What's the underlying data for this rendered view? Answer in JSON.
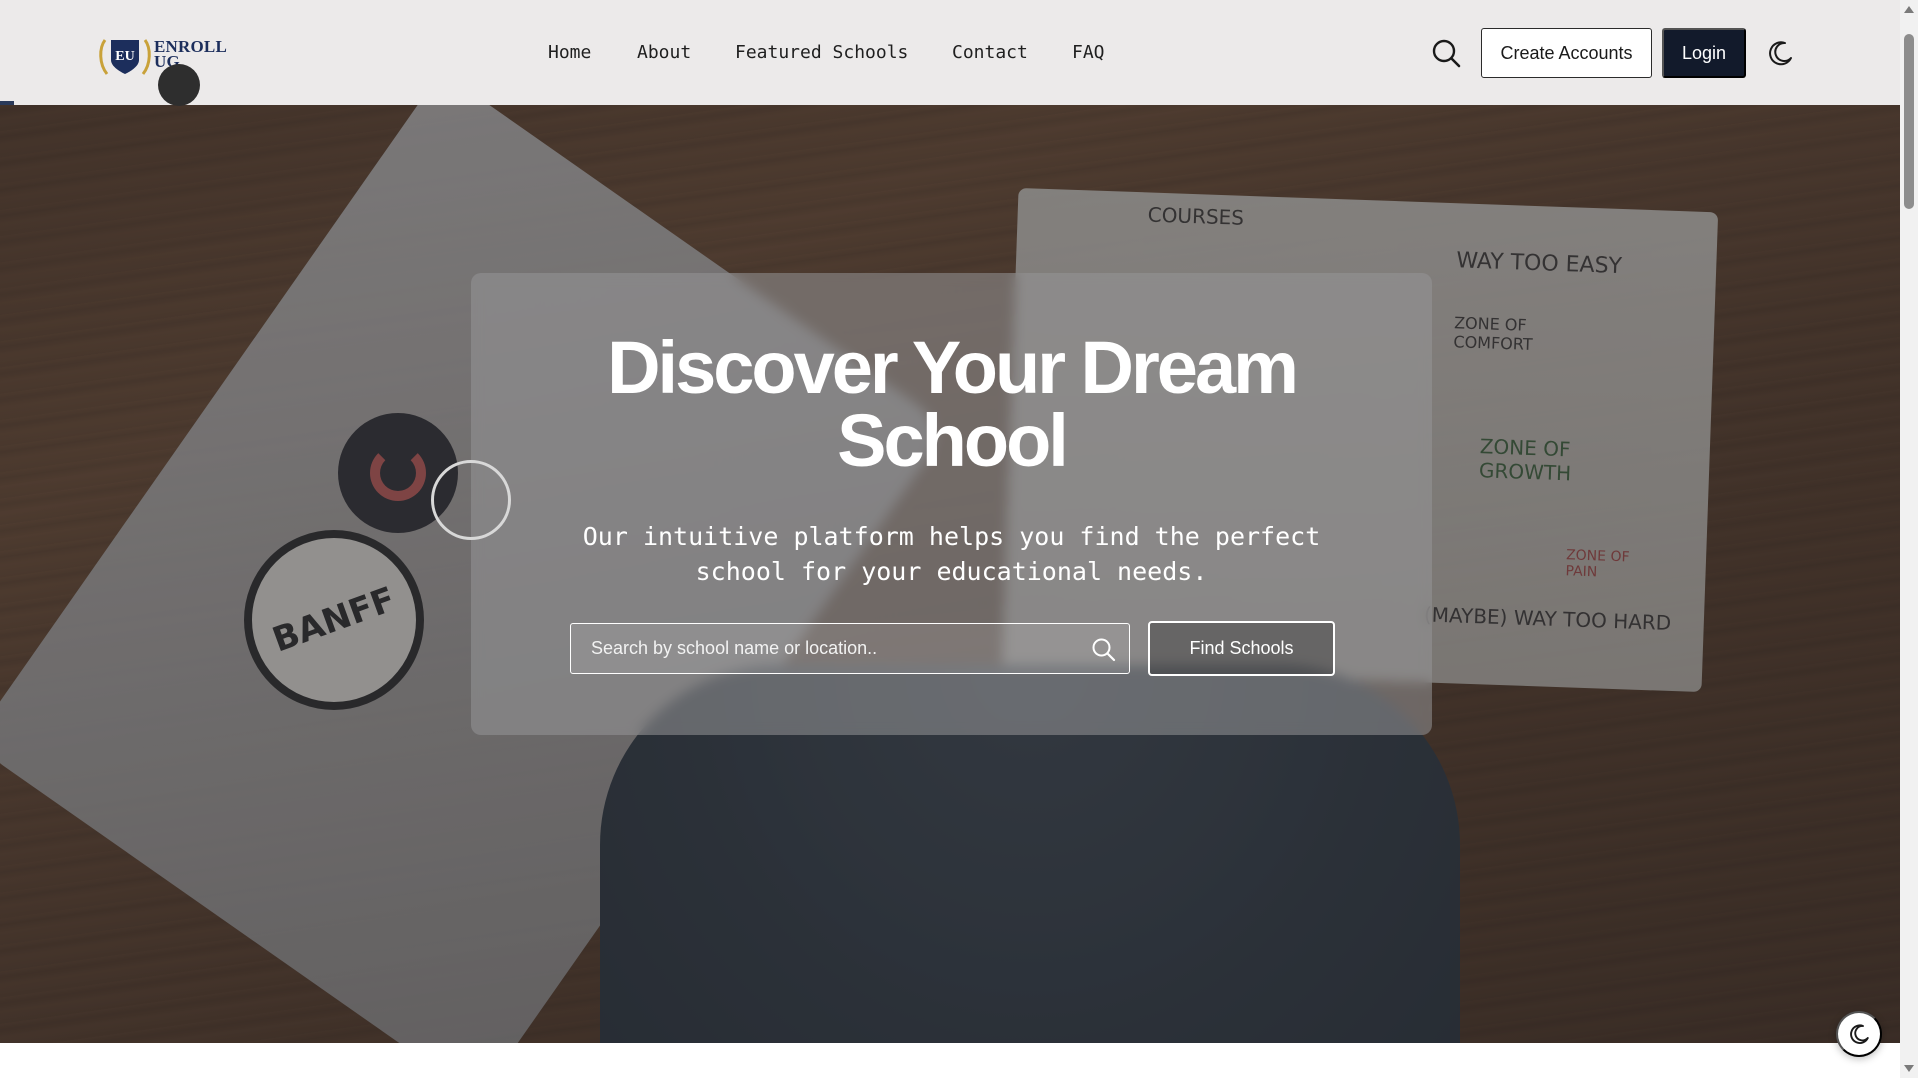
{
  "brand": {
    "logo_initials": "EU",
    "logo_line1": "ENROLL",
    "logo_line2": "UG"
  },
  "nav": {
    "links": [
      "Home",
      "About",
      "Featured Schools",
      "Contact",
      "FAQ"
    ],
    "create_label": "Create Accounts",
    "login_label": "Login",
    "search_icon": "search-icon",
    "theme_icon": "moon-icon"
  },
  "hero": {
    "title_line1": "Discover Your Dream",
    "title_line2": "School",
    "subtitle": "Our intuitive platform helps you find the perfect school for your educational needs.",
    "search_placeholder": "Search by school name or location..",
    "search_value": "",
    "find_label": "Find Schools"
  },
  "background": {
    "notebook_heading": "COURSES",
    "notebook_line1": "WAY TOO EASY",
    "notebook_line2": "ZONE OF COMFORT",
    "notebook_line3": "ZONE OF GROWTH",
    "notebook_line4": "ZONE OF PAIN",
    "notebook_line5": "(MAYBE) WAY TOO HARD",
    "sticker_text": "BANFF"
  },
  "colors": {
    "nav_bg": "#eceaea",
    "login_bg": "#121a2b",
    "brand_navy": "#1c2e5c"
  }
}
